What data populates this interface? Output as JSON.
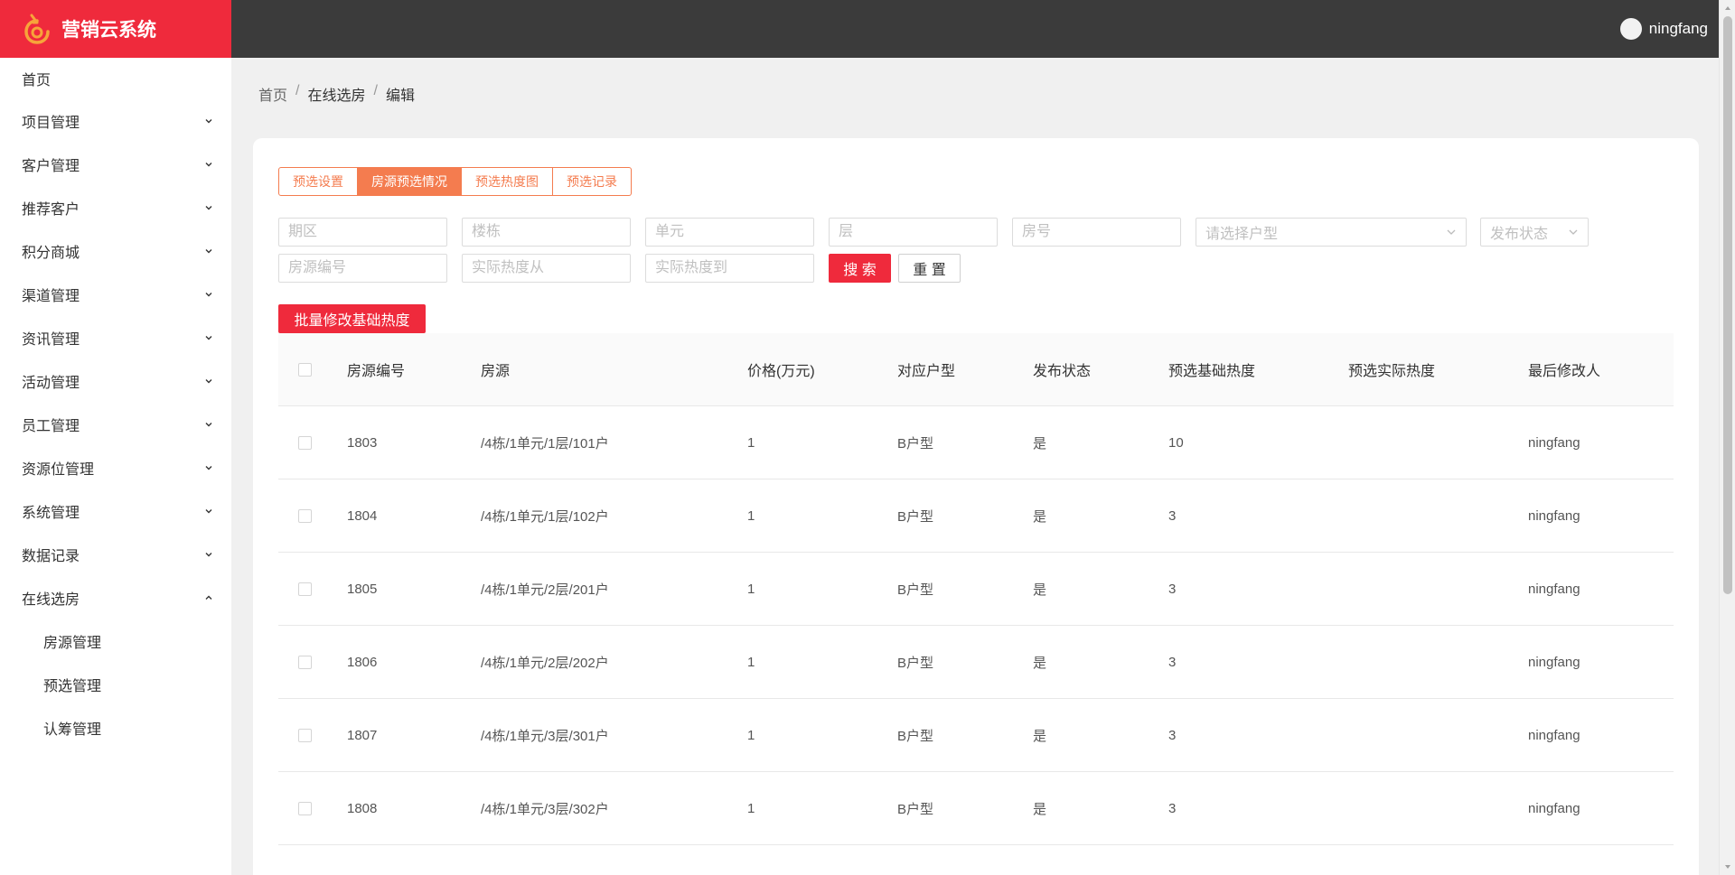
{
  "app": {
    "title": "营销云系统"
  },
  "user": {
    "name": "ningfang"
  },
  "sidebar": {
    "items": [
      {
        "label": "首页"
      },
      {
        "label": "项目管理"
      },
      {
        "label": "客户管理"
      },
      {
        "label": "推荐客户"
      },
      {
        "label": "积分商城"
      },
      {
        "label": "渠道管理"
      },
      {
        "label": "资讯管理"
      },
      {
        "label": "活动管理"
      },
      {
        "label": "员工管理"
      },
      {
        "label": "资源位管理"
      },
      {
        "label": "系统管理"
      },
      {
        "label": "数据记录"
      },
      {
        "label": "在线选房"
      }
    ],
    "submenu": [
      {
        "label": "房源管理"
      },
      {
        "label": "预选管理"
      },
      {
        "label": "认筹管理"
      }
    ]
  },
  "breadcrumb": {
    "home": "首页",
    "section": "在线选房",
    "current": "编辑",
    "sep": "/"
  },
  "tabs": [
    {
      "label": "预选设置"
    },
    {
      "label": "房源预选情况"
    },
    {
      "label": "预选热度图"
    },
    {
      "label": "预选记录"
    }
  ],
  "filters": {
    "phase": "期区",
    "building": "楼栋",
    "unit": "单元",
    "floor": "层",
    "room": "房号",
    "house_type": "请选择户型",
    "publish_status": "发布状态",
    "house_code": "房源编号",
    "heat_from": "实际热度从",
    "heat_to": "实际热度到",
    "search": "搜 索",
    "reset": "重 置"
  },
  "actions": {
    "batch_edit": "批量修改基础热度"
  },
  "table": {
    "headers": [
      "房源编号",
      "房源",
      "价格(万元)",
      "对应户型",
      "发布状态",
      "预选基础热度",
      "预选实际热度",
      "最后修改人"
    ],
    "rows": [
      {
        "code": "1803",
        "house": "/4栋/1单元/1层/101户",
        "price": "1",
        "type": "B户型",
        "published": "是",
        "base_heat": "10",
        "actual_heat": "",
        "modifier": "ningfang"
      },
      {
        "code": "1804",
        "house": "/4栋/1单元/1层/102户",
        "price": "1",
        "type": "B户型",
        "published": "是",
        "base_heat": "3",
        "actual_heat": "",
        "modifier": "ningfang"
      },
      {
        "code": "1805",
        "house": "/4栋/1单元/2层/201户",
        "price": "1",
        "type": "B户型",
        "published": "是",
        "base_heat": "3",
        "actual_heat": "",
        "modifier": "ningfang"
      },
      {
        "code": "1806",
        "house": "/4栋/1单元/2层/202户",
        "price": "1",
        "type": "B户型",
        "published": "是",
        "base_heat": "3",
        "actual_heat": "",
        "modifier": "ningfang"
      },
      {
        "code": "1807",
        "house": "/4栋/1单元/3层/301户",
        "price": "1",
        "type": "B户型",
        "published": "是",
        "base_heat": "3",
        "actual_heat": "",
        "modifier": "ningfang"
      },
      {
        "code": "1808",
        "house": "/4栋/1单元/3层/302户",
        "price": "1",
        "type": "B户型",
        "published": "是",
        "base_heat": "3",
        "actual_heat": "",
        "modifier": "ningfang"
      }
    ]
  },
  "colors": {
    "brand": "#ef2a3c",
    "tab_accent": "#f47c4f",
    "topbar": "#3b3b3b"
  },
  "icons": {
    "logo": "logo-icon",
    "avatar": "avatar",
    "chevron_down": "chevron-down-icon",
    "chevron_up": "chevron-up-icon",
    "select_arrow": "chevron-down-icon"
  }
}
